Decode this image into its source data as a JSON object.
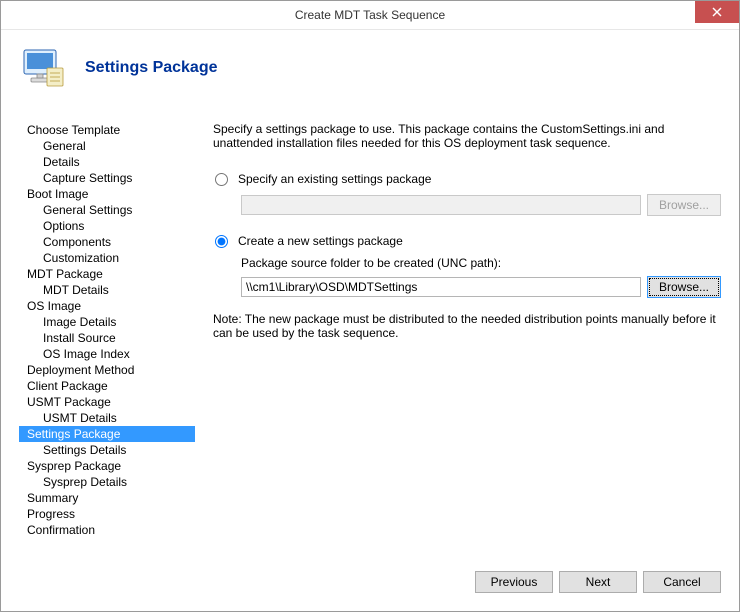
{
  "window": {
    "title": "Create MDT Task Sequence"
  },
  "header": {
    "title": "Settings Package"
  },
  "content": {
    "description": "Specify a settings package to use.  This package contains the CustomSettings.ini and unattended installation files needed for this OS deployment task sequence.",
    "optionExisting": "Specify an existing settings package",
    "optionExistingBrowse": "Browse...",
    "optionNew": "Create a new settings package",
    "optionNewLabel": "Package source folder to be created (UNC path):",
    "optionNewValue": "\\\\cm1\\Library\\OSD\\MDTSettings",
    "optionNewBrowse": "Browse...",
    "note": "Note: The new package must be distributed to the needed distribution points manually before it can be used by the task sequence."
  },
  "sidebar": {
    "items": [
      {
        "label": "Choose Template",
        "level": 0
      },
      {
        "label": "General",
        "level": 1
      },
      {
        "label": "Details",
        "level": 1
      },
      {
        "label": "Capture Settings",
        "level": 1
      },
      {
        "label": "Boot Image",
        "level": 0
      },
      {
        "label": "General Settings",
        "level": 1
      },
      {
        "label": "Options",
        "level": 1
      },
      {
        "label": "Components",
        "level": 1
      },
      {
        "label": "Customization",
        "level": 1
      },
      {
        "label": "MDT Package",
        "level": 0
      },
      {
        "label": "MDT Details",
        "level": 1
      },
      {
        "label": "OS Image",
        "level": 0
      },
      {
        "label": "Image Details",
        "level": 1
      },
      {
        "label": "Install Source",
        "level": 1
      },
      {
        "label": "OS Image Index",
        "level": 1
      },
      {
        "label": "Deployment Method",
        "level": 0
      },
      {
        "label": "Client Package",
        "level": 0
      },
      {
        "label": "USMT Package",
        "level": 0
      },
      {
        "label": "USMT Details",
        "level": 1
      },
      {
        "label": "Settings Package",
        "level": 0,
        "selected": true
      },
      {
        "label": "Settings Details",
        "level": 1
      },
      {
        "label": "Sysprep Package",
        "level": 0
      },
      {
        "label": "Sysprep Details",
        "level": 1
      },
      {
        "label": "Summary",
        "level": 0
      },
      {
        "label": "Progress",
        "level": 0
      },
      {
        "label": "Confirmation",
        "level": 0
      }
    ]
  },
  "footer": {
    "previous": "Previous",
    "next": "Next",
    "cancel": "Cancel"
  }
}
